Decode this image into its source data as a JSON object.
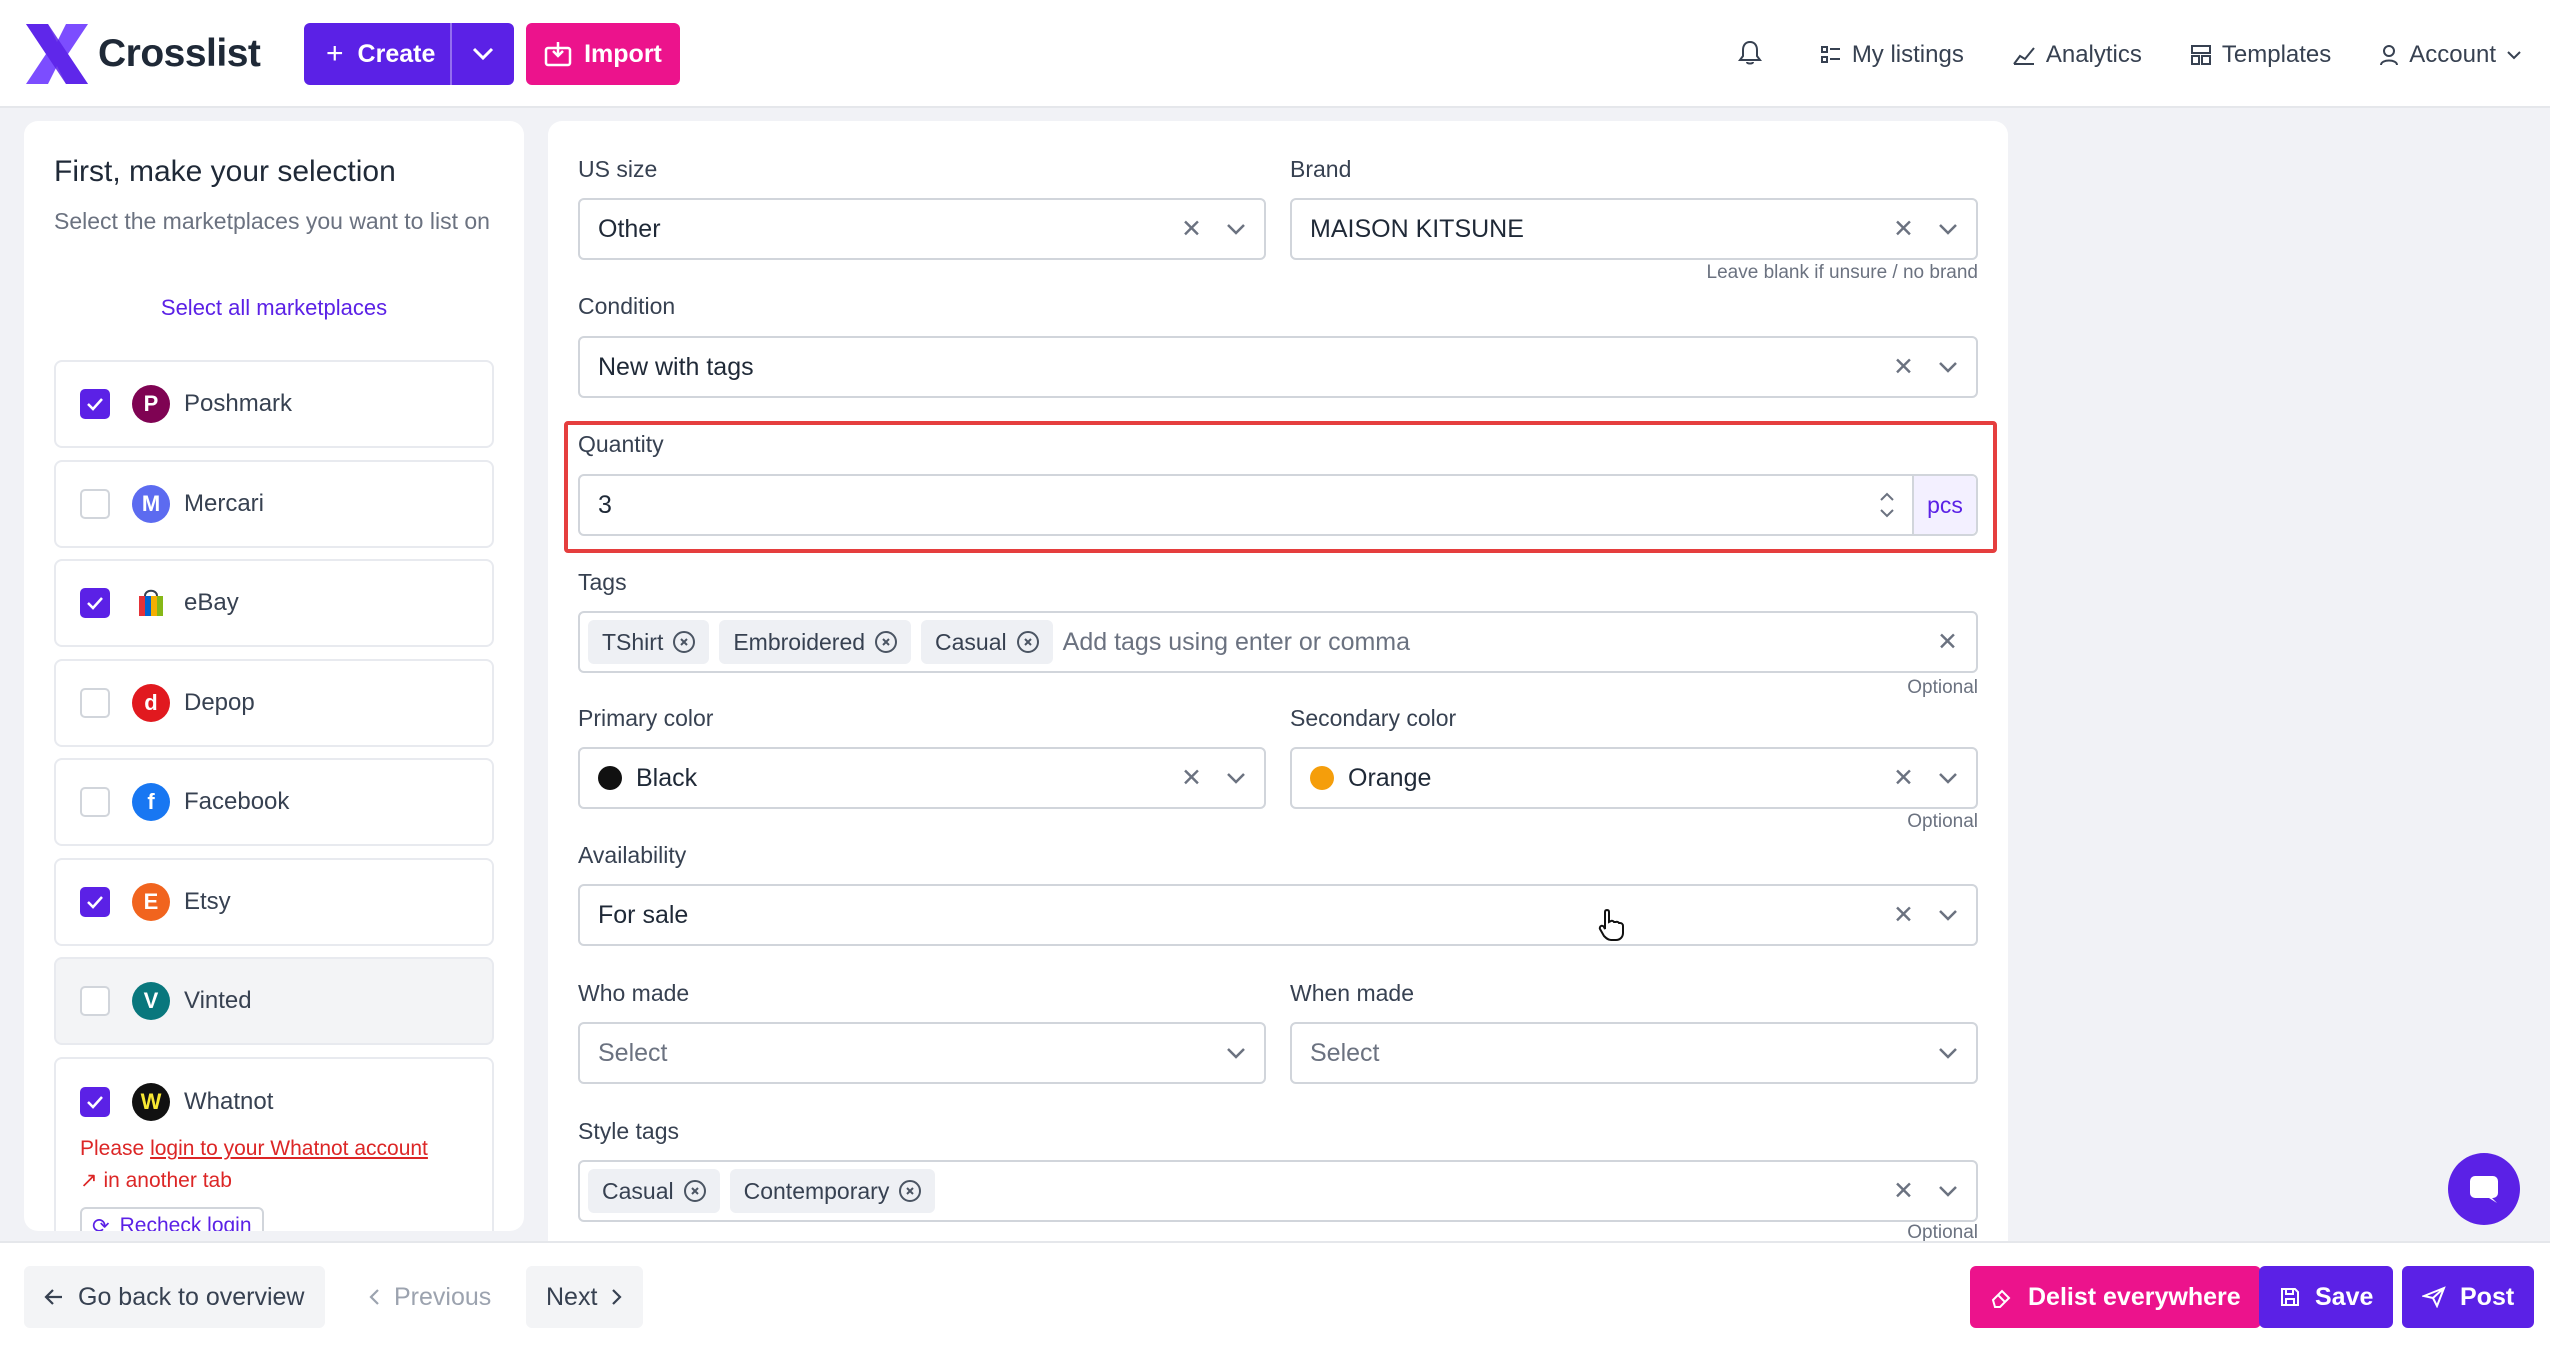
{
  "header": {
    "logo_text": "Crosslist",
    "create_label": "Create",
    "import_label": "Import",
    "nav": [
      "My listings",
      "Analytics",
      "Templates",
      "Account"
    ]
  },
  "sidebar": {
    "title": "First, make your selection",
    "subtitle": "Select the marketplaces you want to list on",
    "select_all": "Select all marketplaces",
    "marketplaces": [
      {
        "name": "Poshmark",
        "checked": true,
        "color": "#7f0353"
      },
      {
        "name": "Mercari",
        "checked": false,
        "color": "#5c6bf0"
      },
      {
        "name": "eBay",
        "checked": true,
        "color": "#e53238"
      },
      {
        "name": "Depop",
        "checked": false,
        "color": "#e1191f"
      },
      {
        "name": "Facebook",
        "checked": false,
        "color": "#1877f2"
      },
      {
        "name": "Etsy",
        "checked": true,
        "color": "#f1641e"
      },
      {
        "name": "Vinted",
        "checked": false,
        "color": "#09777d"
      },
      {
        "name": "Whatnot",
        "checked": true,
        "color": "#111111"
      }
    ],
    "whatnot_warning_prefix": "Please",
    "whatnot_warning_link": "login to your Whatnot account",
    "whatnot_warning_suffix": "in another tab",
    "recheck_label": "Recheck login"
  },
  "form": {
    "us_size": {
      "label": "US size",
      "value": "Other"
    },
    "brand": {
      "label": "Brand",
      "value": "MAISON KITSUNE",
      "hint": "Leave blank if unsure / no brand"
    },
    "condition": {
      "label": "Condition",
      "value": "New with tags"
    },
    "quantity": {
      "label": "Quantity",
      "value": "3",
      "unit": "pcs"
    },
    "tags": {
      "label": "Tags",
      "items": [
        "TShirt",
        "Embroidered",
        "Casual"
      ],
      "placeholder": "Add tags using enter or comma",
      "hint": "Optional"
    },
    "primary_color": {
      "label": "Primary color",
      "value": "Black",
      "swatch": "#111111"
    },
    "secondary_color": {
      "label": "Secondary color",
      "value": "Orange",
      "swatch": "#f59e0b",
      "hint": "Optional"
    },
    "availability": {
      "label": "Availability",
      "value": "For sale"
    },
    "who_made": {
      "label": "Who made",
      "value": "Select"
    },
    "when_made": {
      "label": "When made",
      "value": "Select"
    },
    "style_tags": {
      "label": "Style tags",
      "items": [
        "Casual",
        "Contemporary"
      ],
      "hint": "Optional"
    }
  },
  "footer": {
    "back_label": "Go back to overview",
    "previous_label": "Previous",
    "next_label": "Next",
    "delist_label": "Delist everywhere",
    "save_label": "Save",
    "post_label": "Post"
  }
}
